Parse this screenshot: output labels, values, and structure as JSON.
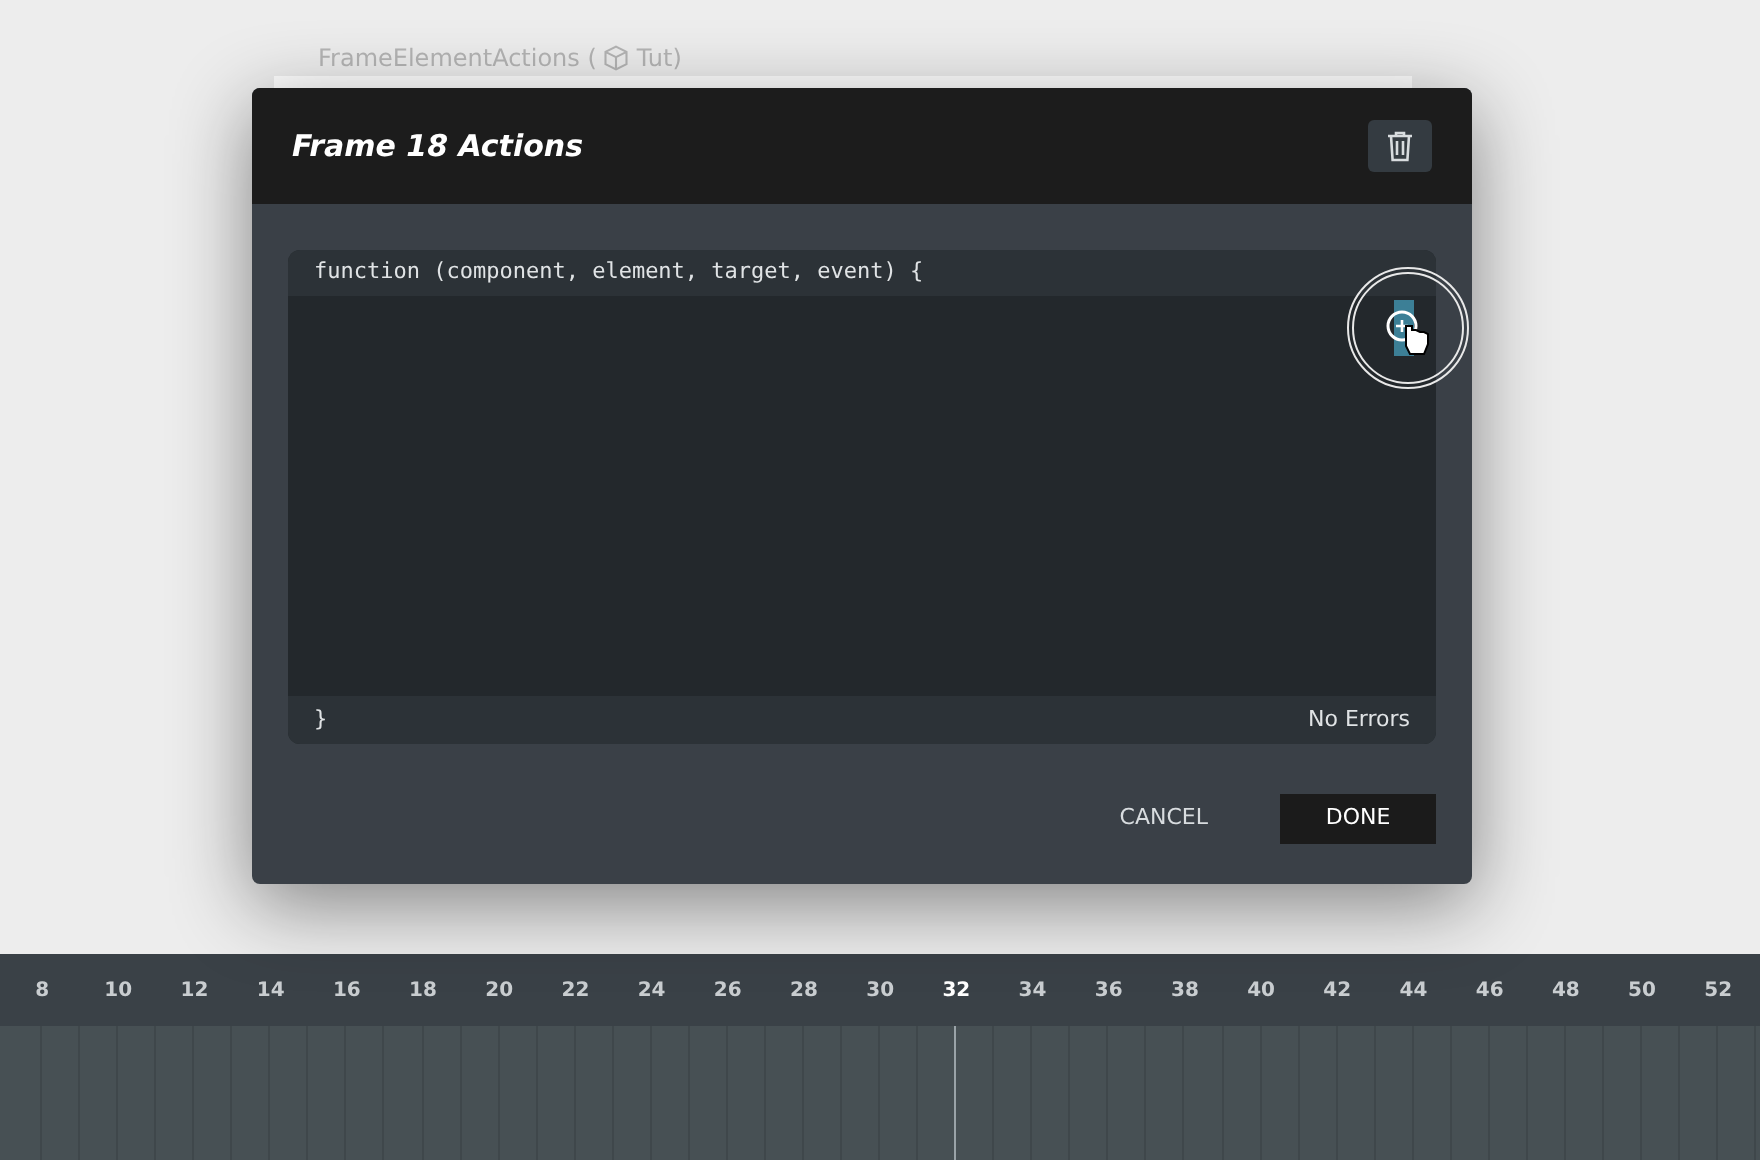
{
  "breadcrumb": {
    "name": "FrameElementActions (",
    "project": "Tut)"
  },
  "dialog": {
    "title": "Frame 18 Actions"
  },
  "editor": {
    "signature": "function (component, element, target, event) {",
    "closing": "}",
    "status": "No Errors"
  },
  "buttons": [
    {
      "label": "CANCEL",
      "kind": "secondary"
    },
    {
      "label": "DONE",
      "kind": "primary"
    }
  ],
  "timeline": {
    "ticks": [
      {
        "label": "8",
        "selected": false
      },
      {
        "label": "10",
        "selected": false
      },
      {
        "label": "12",
        "selected": false
      },
      {
        "label": "14",
        "selected": false
      },
      {
        "label": "16",
        "selected": false
      },
      {
        "label": "18",
        "selected": false
      },
      {
        "label": "20",
        "selected": false
      },
      {
        "label": "22",
        "selected": false
      },
      {
        "label": "24",
        "selected": false
      },
      {
        "label": "26",
        "selected": false
      },
      {
        "label": "28",
        "selected": false
      },
      {
        "label": "30",
        "selected": false
      },
      {
        "label": "32",
        "selected": true
      },
      {
        "label": "34",
        "selected": false
      },
      {
        "label": "36",
        "selected": false
      },
      {
        "label": "38",
        "selected": false
      },
      {
        "label": "40",
        "selected": false
      },
      {
        "label": "42",
        "selected": false
      },
      {
        "label": "44",
        "selected": false
      },
      {
        "label": "46",
        "selected": false
      },
      {
        "label": "48",
        "selected": false
      },
      {
        "label": "50",
        "selected": false
      },
      {
        "label": "52",
        "selected": false
      }
    ]
  }
}
